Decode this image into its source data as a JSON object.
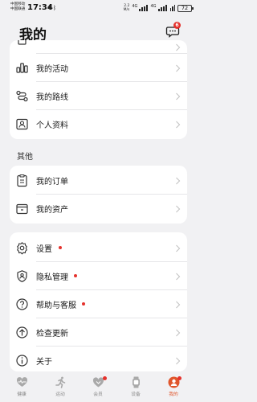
{
  "status_bar": {
    "carrier_line1": "中国移动",
    "carrier_line2": "中国联通",
    "time": "17:34",
    "net_speed_value": "2.2",
    "net_speed_unit": "M/s",
    "signal_label_1": "4G",
    "signal_label_2": "4G",
    "battery": "72"
  },
  "header": {
    "title": "我的",
    "message_badge": "6"
  },
  "card_top": {
    "items": [
      {
        "label": "我的活动",
        "icon": "chart-icon"
      },
      {
        "label": "我的路线",
        "icon": "route-icon"
      },
      {
        "label": "个人资料",
        "icon": "profile-icon"
      }
    ]
  },
  "section_other": {
    "title": "其他",
    "items": [
      {
        "label": "我的订单",
        "icon": "order-icon"
      },
      {
        "label": "我的资产",
        "icon": "wallet-icon"
      }
    ]
  },
  "card_settings": {
    "items": [
      {
        "label": "设置",
        "icon": "gear-icon",
        "dot": true
      },
      {
        "label": "隐私管理",
        "icon": "privacy-icon",
        "dot": true
      },
      {
        "label": "帮助与客服",
        "icon": "help-icon",
        "dot": true
      },
      {
        "label": "检查更新",
        "icon": "update-icon",
        "dot": false
      },
      {
        "label": "关于",
        "icon": "info-icon",
        "dot": false
      }
    ]
  },
  "bottom_nav": {
    "tabs": [
      {
        "label": "健康",
        "icon": "heart-icon",
        "active": false
      },
      {
        "label": "运动",
        "icon": "running-icon",
        "active": false
      },
      {
        "label": "会员",
        "icon": "member-icon",
        "active": false
      },
      {
        "label": "设备",
        "icon": "watch-icon",
        "active": false
      },
      {
        "label": "我的",
        "icon": "me-icon",
        "active": true
      }
    ]
  },
  "colors": {
    "background": "#f1f1f3",
    "card": "#ffffff",
    "dot": "#e5322d",
    "active_tab": "#e0562c",
    "chevron": "#c4c4c4"
  }
}
